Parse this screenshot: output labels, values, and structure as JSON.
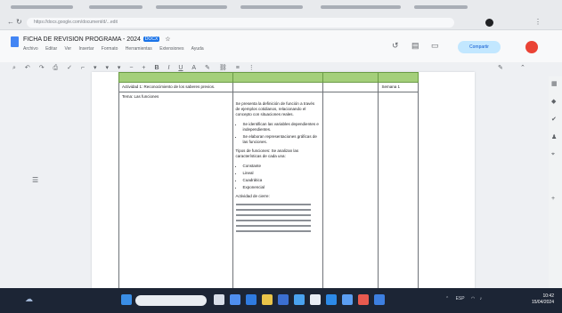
{
  "browser": {
    "address": "https://docs.google.com/document/d/...edit"
  },
  "document": {
    "title": "FICHA DE REVISION PROGRAMA - 2024",
    "badge": "DOCX",
    "menus": [
      "Archivo",
      "Editar",
      "Ver",
      "Insertar",
      "Formato",
      "Herramientas",
      "Extensiones",
      "Ayuda"
    ],
    "share_label": "Compartir"
  },
  "table": {
    "row1": {
      "c1": "Actividad 1: Reconocimiento de los saberes previos.",
      "c4": "Semana 1"
    },
    "row2": {
      "c1": "Tema: Las funciones",
      "c2_intro": "Se presenta la definición de función a través de ejemplos cotidianos, relacionando el concepto con situaciones reales.",
      "c2_bullets": [
        "Se identifican las variables dependientes e independientes.",
        "Se elaboran representaciones gráficas de las funciones."
      ],
      "c2_heading": "Tipos de funciones: Se analizan las características de cada una:",
      "c2_list": [
        "Constante",
        "Lineal",
        "Cuadrática",
        "Exponencial"
      ],
      "c2_closing": "Actividad de cierre:"
    }
  },
  "taskbar": {
    "language": "ESP",
    "time": "10:42",
    "date": "15/04/2024"
  }
}
